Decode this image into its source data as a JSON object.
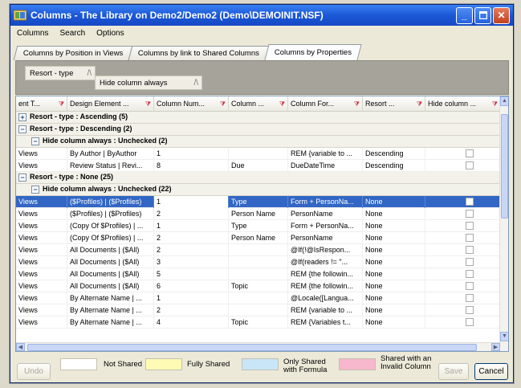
{
  "window": {
    "title": "Columns - The Library on Demo2/Demo2 (Demo\\DEMOINIT.NSF)",
    "controls": [
      "minimize-icon",
      "maximize-icon",
      "close-icon"
    ]
  },
  "menu": [
    "Columns",
    "Search",
    "Options"
  ],
  "tabs": [
    "Columns by Position in Views",
    "Columns by link to Shared Columns",
    "Columns by Properties"
  ],
  "group_chips": {
    "first": "Resort - type",
    "second": "Hide column always"
  },
  "columns": [
    "ent T...",
    "Design Element ...",
    "Column Num...",
    "Column ...",
    "Column For...",
    "Resort ...",
    "Hide column ..."
  ],
  "groups": {
    "ascending": "Resort - type : Ascending (5)",
    "descending": "Resort - type : Descending (2)",
    "desc_sub": "Hide column always : Unchecked (2)",
    "none": "Resort - type : None (25)",
    "none_sub": "Hide column always : Unchecked (22)"
  },
  "desc_rows": [
    [
      "Views",
      "By Author | ByAuthor",
      "1",
      "",
      "REM {variable to ...",
      "Descending"
    ],
    [
      "Views",
      "Review Status | Revi...",
      "8",
      "Due",
      "DueDateTime",
      "Descending"
    ]
  ],
  "none_rows": [
    [
      "Views",
      "($Profiles) | ($Profiles)",
      "1",
      "Type",
      "Form + PersonNa...",
      "None"
    ],
    [
      "Views",
      "($Profiles) | ($Profiles)",
      "2",
      "Person Name",
      "PersonName",
      "None"
    ],
    [
      "Views",
      "(Copy Of $Profiles) | ...",
      "1",
      "Type",
      "Form + PersonNa...",
      "None"
    ],
    [
      "Views",
      "(Copy Of $Profiles) | ...",
      "2",
      "Person Name",
      "PersonName",
      "None"
    ],
    [
      "Views",
      "All Documents | ($All)",
      "2",
      "",
      "@If(!@IsRespon...",
      "None"
    ],
    [
      "Views",
      "All Documents | ($All)",
      "3",
      "",
      "@If(readers != \"...",
      "None"
    ],
    [
      "Views",
      "All Documents | ($All)",
      "5",
      "",
      "REM {the followin...",
      "None"
    ],
    [
      "Views",
      "All Documents | ($All)",
      "6",
      "Topic",
      "REM {the followin...",
      "None"
    ],
    [
      "Views",
      "By Alternate Name | ...",
      "1",
      "",
      "@Locale([Langua...",
      "None"
    ],
    [
      "Views",
      "By Alternate Name | ...",
      "2",
      "",
      "REM {variable to ...",
      "None"
    ],
    [
      "Views",
      "By Alternate Name | ...",
      "4",
      "Topic",
      "REM {Variables t...",
      "None"
    ]
  ],
  "legend": [
    {
      "label": "Not Shared",
      "color": "#ffffff"
    },
    {
      "label": "Fully Shared",
      "color": "#fdfab4"
    },
    {
      "label": "Only Shared with Formula",
      "color": "#c8e6f8"
    },
    {
      "label": "Shared with an Invalid Column",
      "color": "#f7b7cc"
    }
  ],
  "buttons": {
    "undo": "Undo",
    "save": "Save",
    "cancel": "Cancel"
  }
}
